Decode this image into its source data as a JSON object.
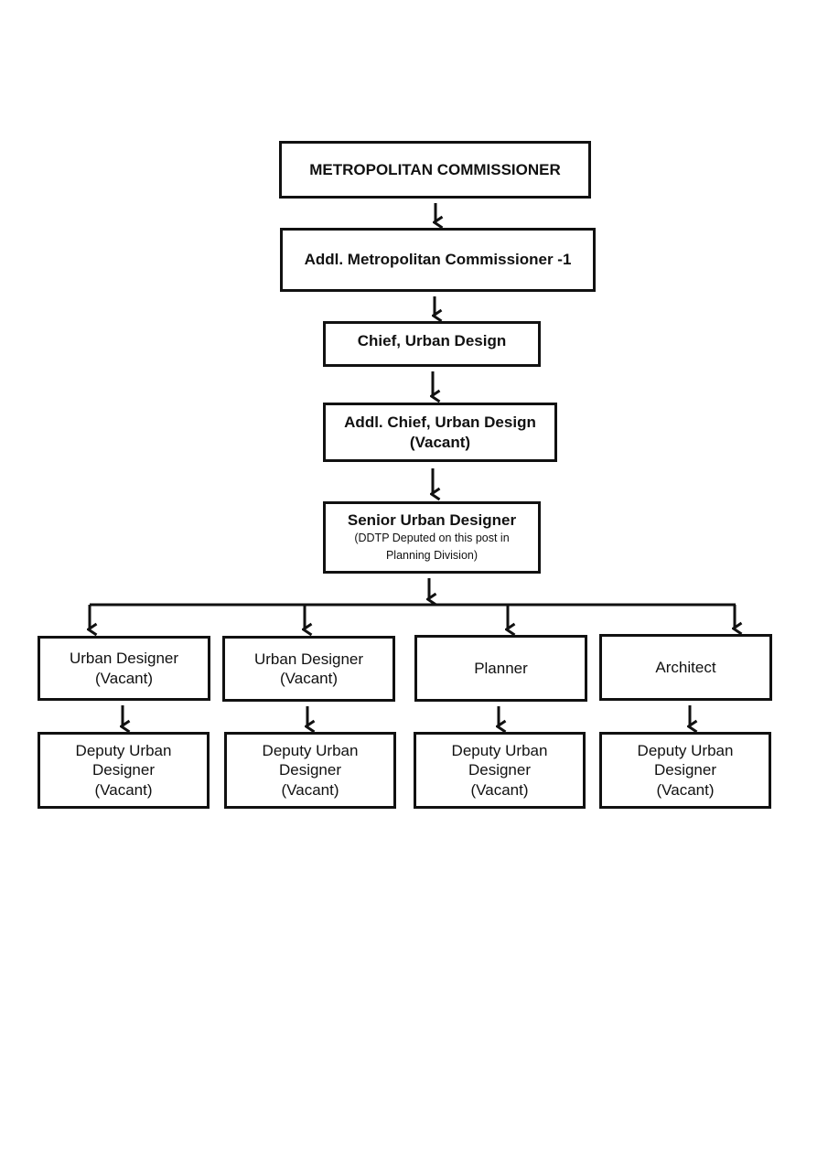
{
  "nodes": {
    "mc": {
      "title": "METROPOLITAN COMMISSIONER"
    },
    "amc": {
      "title": "Addl. Metropolitan Commissioner -1"
    },
    "chief": {
      "title": "Chief, Urban  Design"
    },
    "addl_chief": {
      "title": "Addl. Chief, Urban Design",
      "status": "(Vacant)"
    },
    "senior": {
      "title": "Senior Urban  Designer",
      "note1": "(DDTP Deputed on this post in",
      "note2": "Planning Division)"
    },
    "level1": [
      {
        "title": "Urban Designer",
        "status": "(Vacant)"
      },
      {
        "title": "Urban Designer",
        "status": "(Vacant)"
      },
      {
        "title": "Planner"
      },
      {
        "title": "Architect"
      }
    ],
    "level2": [
      {
        "line1": "Deputy Urban",
        "line2": "Designer",
        "status": "(Vacant)"
      },
      {
        "line1": "Deputy Urban",
        "line2": "Designer",
        "status": "(Vacant)"
      },
      {
        "line1": "Deputy Urban",
        "line2": "Designer",
        "status": "(Vacant)"
      },
      {
        "line1": "Deputy Urban",
        "line2": "Designer",
        "status": "(Vacant)"
      }
    ]
  },
  "colors": {
    "line": "#111111",
    "background": "#ffffff"
  }
}
